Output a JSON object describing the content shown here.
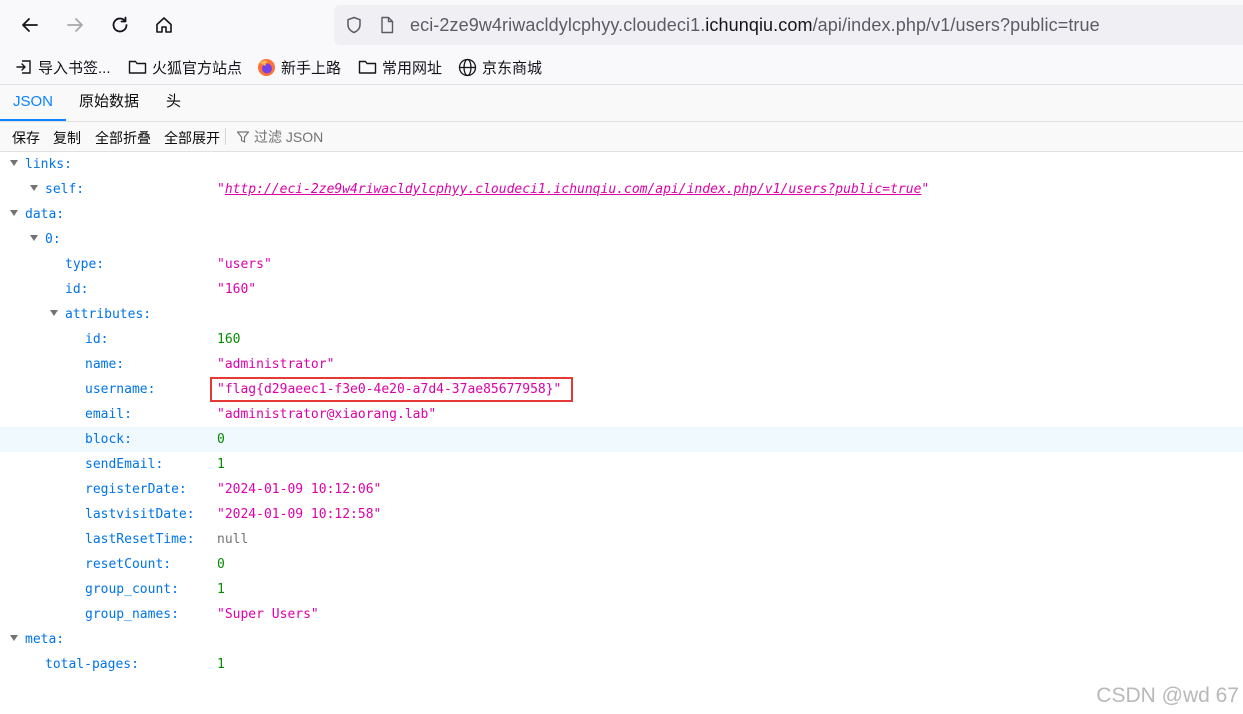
{
  "browser": {
    "url": {
      "prefix": "eci-2ze9w4riwacldylcphyy.cloudeci1.",
      "host": "ichunqiu.com",
      "path": "/api/index.php/v1/users?public=true"
    },
    "bookmarks": [
      {
        "label": "导入书签...",
        "icon": "import-icon"
      },
      {
        "label": "火狐官方站点",
        "icon": "folder-icon"
      },
      {
        "label": "新手上路",
        "icon": "firefox-icon"
      },
      {
        "label": "常用网址",
        "icon": "folder-icon"
      },
      {
        "label": "京东商城",
        "icon": "globe-icon"
      }
    ]
  },
  "viewer": {
    "tabs": [
      "JSON",
      "原始数据",
      "头"
    ],
    "active_tab": "JSON",
    "toolbar": {
      "save": "保存",
      "copy": "复制",
      "collapse_all": "全部折叠",
      "expand_all": "全部展开",
      "filter_placeholder": "过滤 JSON"
    }
  },
  "json_tree": {
    "links_key": "links:",
    "self_key": "self:",
    "self_value": "http://eci-2ze9w4riwacldylcphyy.cloudeci1.ichunqiu.com/api/index.php/v1/users?public=true",
    "data_key": "data:",
    "item0_key": "0:",
    "type_key": "type:",
    "type_value": "\"users\"",
    "id_key": "id:",
    "id_value": "\"160\"",
    "attributes_key": "attributes:",
    "attributes": [
      {
        "key": "id:",
        "value": "160",
        "kind": "num"
      },
      {
        "key": "name:",
        "value": "\"administrator\"",
        "kind": "str"
      },
      {
        "key": "username:",
        "value": "\"flag{d29aeec1-f3e0-4e20-a7d4-37ae85677958}\"",
        "kind": "str"
      },
      {
        "key": "email:",
        "value": "\"administrator@xiaorang.lab\"",
        "kind": "str"
      },
      {
        "key": "block:",
        "value": "0",
        "kind": "num"
      },
      {
        "key": "sendEmail:",
        "value": "1",
        "kind": "num"
      },
      {
        "key": "registerDate:",
        "value": "\"2024-01-09 10:12:06\"",
        "kind": "str"
      },
      {
        "key": "lastvisitDate:",
        "value": "\"2024-01-09 10:12:58\"",
        "kind": "str"
      },
      {
        "key": "lastResetTime:",
        "value": "null",
        "kind": "null"
      },
      {
        "key": "resetCount:",
        "value": "0",
        "kind": "num"
      },
      {
        "key": "group_count:",
        "value": "1",
        "kind": "num"
      },
      {
        "key": "group_names:",
        "value": "\"Super Users\"",
        "kind": "str"
      }
    ],
    "meta_key": "meta:",
    "total_pages_key": "total-pages:",
    "total_pages_value": "1"
  },
  "watermark": "CSDN @wd 67",
  "colors": {
    "accent": "#0a84ff",
    "key": "#0074e8",
    "string": "#dd00a9",
    "number": "#058b00",
    "highlight_box": "#e53935"
  }
}
